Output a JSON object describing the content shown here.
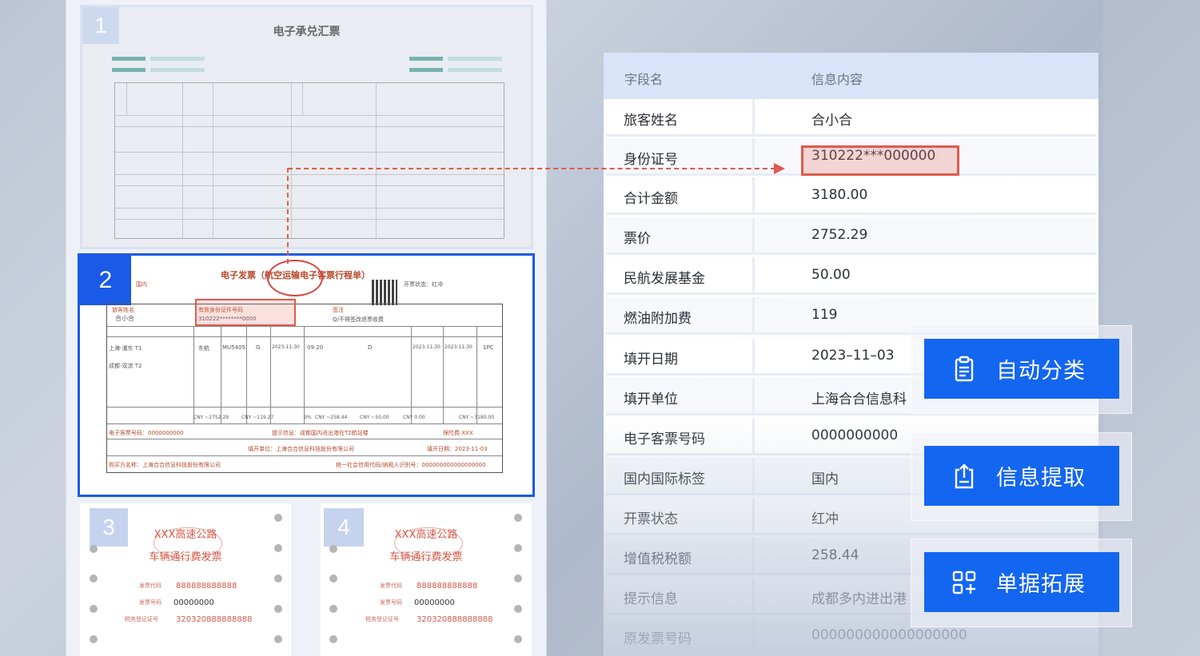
{
  "documents": {
    "card1": {
      "number": "1",
      "title": "电子承兑汇票"
    },
    "card2": {
      "number": "2",
      "title": "电子发票（航空运输电子客票行程单）",
      "type_label": "国内",
      "passenger_label": "旅客姓名",
      "passenger_name": "合小合",
      "id_label": "有效身份证件号码",
      "id_value": "310222********0000",
      "note_label": "签注",
      "note_value": "Q/不得签改退票收费",
      "status_label": "开票状态：红冲",
      "route_from": "上海-浦东 T1",
      "route_to": "成都-双流 T2",
      "carrier": "东航",
      "flight": "MU5405",
      "seat_class": "G",
      "date": "2023-11-30",
      "time": "09:20",
      "fare_basis": "D",
      "valid_from": "2023-11-30",
      "valid_to": "2023-11-30",
      "baggage": "1PC",
      "fare": "CNY ~2752.29",
      "fuel": "CNY ~119.27",
      "tax_rate": "9%",
      "tax": "CNY ~258.44",
      "civil_fund": "CNY ~50.00",
      "other_tax": "CNY 0.00",
      "total": "CNY ~3180.00",
      "ticket_no": "电子客票号码：0000000000",
      "hint": "提示信息：成都国内进出港在T2航站楼",
      "insurance": "保险费:XXX",
      "seller": "填开单位：上海合合信息科技股份有限公司",
      "issue_date": "填开日期：2023-11-03",
      "buyer": "购买方名称：上海合合信息科技股份有限公司",
      "buyer_tax": "统一社会信用代码/纳税人识别号：000000000000000000"
    },
    "toll_cards": [
      {
        "number": "3",
        "road": "XXX高速公路",
        "title": "车辆通行费发票",
        "code_label": "发票代码",
        "code_value": "888888888888",
        "num_label": "发票号码",
        "num_value": "00000000",
        "tax_label": "税务登记证号",
        "tax_value": "320320888888888"
      },
      {
        "number": "4",
        "road": "XXX高速公路",
        "title": "车辆通行费发票",
        "code_label": "发票代码",
        "code_value": "888888888888",
        "num_label": "发票号码",
        "num_value": "00000000",
        "tax_label": "税务登记证号",
        "tax_value": "320320888888888"
      }
    ]
  },
  "field_table": {
    "header_field": "字段名",
    "header_value": "信息内容",
    "rows": [
      {
        "name": "旅客姓名",
        "value": "合小合"
      },
      {
        "name": "身份证号",
        "value": "310222***000000"
      },
      {
        "name": "合计金额",
        "value": "3180.00"
      },
      {
        "name": "票价",
        "value": "2752.29"
      },
      {
        "name": "民航发展基金",
        "value": "50.00"
      },
      {
        "name": "燃油附加费",
        "value": "119"
      },
      {
        "name": "填开日期",
        "value": "2023–11–03"
      },
      {
        "name": "填开单位",
        "value": "上海合合信息科"
      },
      {
        "name": "电子客票号码",
        "value": "0000000000"
      },
      {
        "name": "国内国际标签",
        "value": "国内"
      },
      {
        "name": "开票状态",
        "value": "红冲"
      },
      {
        "name": "增值税税额",
        "value": "258.44"
      },
      {
        "name": "提示信息",
        "value": "成都多内进出港"
      },
      {
        "name": "原发票号码",
        "value": "000000000000000000"
      }
    ]
  },
  "features": [
    {
      "label": "自动分类",
      "icon": "clipboard-list-icon"
    },
    {
      "label": "信息提取",
      "icon": "clipboard-export-icon"
    },
    {
      "label": "单据拓展",
      "icon": "grid-add-icon"
    }
  ],
  "colors": {
    "accent": "#1366f0",
    "highlight": "#e05a4e",
    "active_border": "#1a5ae6"
  }
}
